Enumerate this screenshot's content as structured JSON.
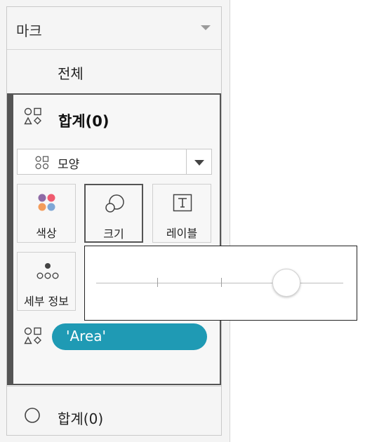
{
  "marks_panel": {
    "title": "마크",
    "all_label": "전체",
    "sum_card": {
      "title": "합계(0)",
      "mark_type": {
        "label": "모양",
        "icon": "shape-icon"
      },
      "tiles": [
        {
          "label": "색상",
          "icon": "color-dots-icon"
        },
        {
          "label": "크기",
          "icon": "size-icon",
          "selected": true
        },
        {
          "label": "레이블",
          "icon": "text-label-icon"
        },
        {
          "label": "세부 정보",
          "icon": "detail-dots-icon"
        }
      ],
      "shape_pill": {
        "text": "'Area'",
        "icon": "shape-icon",
        "color": "#1f9ab4"
      }
    },
    "sum2": {
      "title": "합계(0)",
      "icon": "circle-icon"
    }
  },
  "size_popup": {
    "slider_value": 0.77,
    "tick_marks": 2,
    "thumb_color": "#ffffff"
  }
}
